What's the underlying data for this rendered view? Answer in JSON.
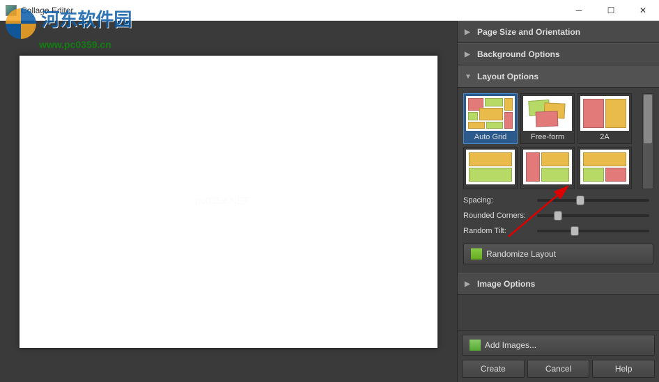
{
  "titlebar": {
    "title": "Collage Editor"
  },
  "watermark": {
    "text1": "河东软件园",
    "text2": "www.pc0359.cn",
    "canvas_mark": "pc0359.NET"
  },
  "panels": {
    "pageSize": {
      "title": "Page Size and Orientation"
    },
    "background": {
      "title": "Background Options"
    },
    "layout": {
      "title": "Layout Options",
      "items": [
        {
          "label": "Auto Grid"
        },
        {
          "label": "Free-form"
        },
        {
          "label": "2A"
        },
        {
          "label": ""
        },
        {
          "label": ""
        },
        {
          "label": ""
        }
      ],
      "spacingLabel": "Spacing:",
      "roundedLabel": "Rounded Corners:",
      "tiltLabel": "Random Tilt:",
      "randomize": "Randomize Layout"
    },
    "image": {
      "title": "Image Options"
    }
  },
  "bottom": {
    "addImages": "Add Images...",
    "create": "Create",
    "cancel": "Cancel",
    "help": "Help"
  },
  "sliders": {
    "spacing": 35,
    "rounded": 15,
    "tilt": 30
  }
}
